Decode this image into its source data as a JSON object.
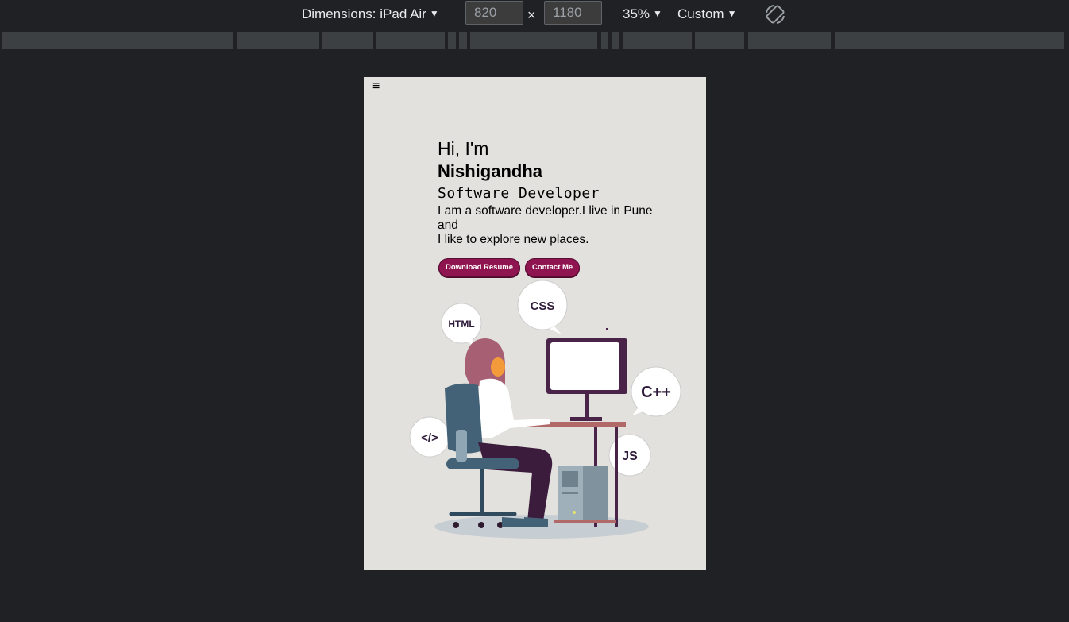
{
  "devtools": {
    "dimensions_label": "Dimensions: iPad Air",
    "width_value": "820",
    "height_value": "1180",
    "times": "×",
    "zoom": "35%",
    "throttle": "Custom",
    "rotate_icon": "rotate-icon",
    "dropdown_icon": "caret-down-icon"
  },
  "page": {
    "menu_icon": "hamburger-icon",
    "menu_glyph": "≡",
    "greeting": "Hi, I'm",
    "name": "Nishigandha",
    "role": "Software Developer",
    "description_line1": "I am a software developer.I live in Pune",
    "description_line2": "and",
    "description_line3": "I like to explore new places.",
    "download_button": "Download Resume",
    "contact_button": "Contact Me",
    "bubbles": {
      "html": "HTML",
      "css": "CSS",
      "cpp": "C++",
      "code": "</>",
      "js": "JS"
    }
  },
  "colors": {
    "viewport_bg": "#e3e1dd",
    "button": "#8e1550",
    "app_bg": "#202124"
  }
}
